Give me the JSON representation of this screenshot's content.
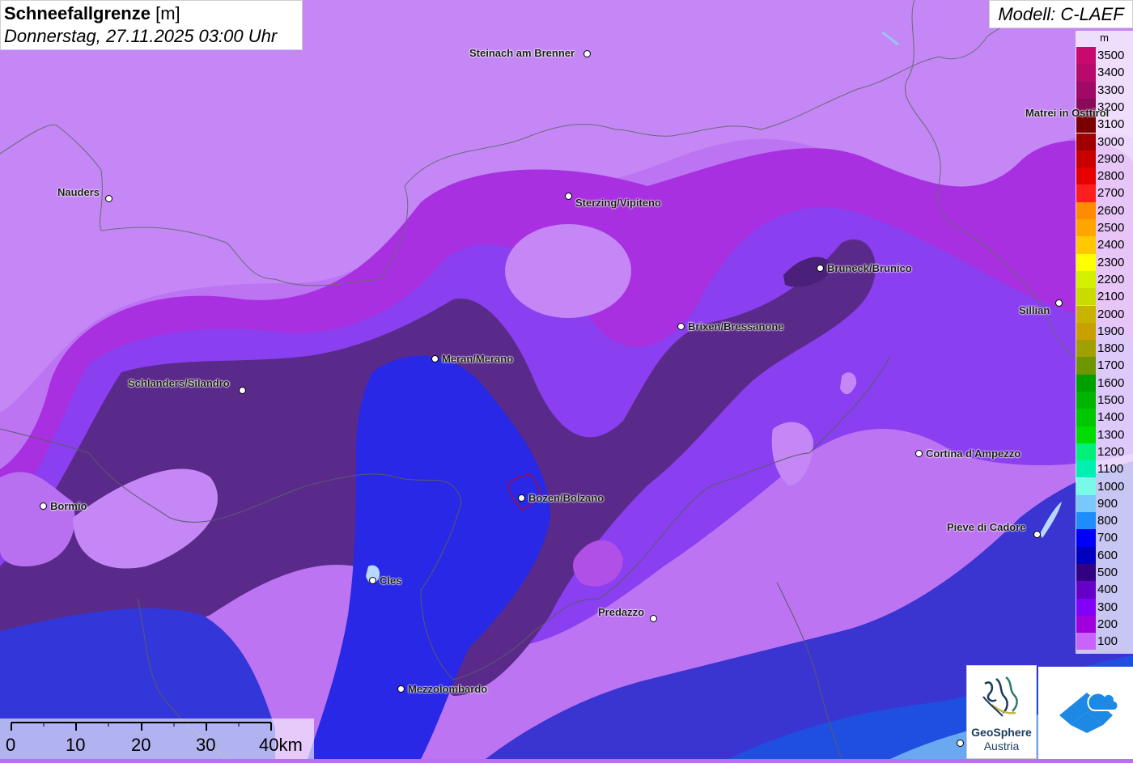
{
  "header": {
    "title_bold": "Schneefallgrenze",
    "title_unit": "[m]",
    "datetime": "Donnerstag, 27.11.2025 03:00 Uhr"
  },
  "model": {
    "label": "Modell: C-LAEF"
  },
  "legend": {
    "unit": "m",
    "entries": [
      {
        "label": "3500",
        "color": "#c80a6e"
      },
      {
        "label": "3400",
        "color": "#b80a6a"
      },
      {
        "label": "3300",
        "color": "#a00a66"
      },
      {
        "label": "3200",
        "color": "#8a0a5a"
      },
      {
        "label": "3100",
        "color": "#7a0000"
      },
      {
        "label": "3000",
        "color": "#a00000"
      },
      {
        "label": "2900",
        "color": "#c80000"
      },
      {
        "label": "2800",
        "color": "#e60000"
      },
      {
        "label": "2700",
        "color": "#ff1e1e"
      },
      {
        "label": "2600",
        "color": "#ff8c00"
      },
      {
        "label": "2500",
        "color": "#ffa500"
      },
      {
        "label": "2400",
        "color": "#ffc800"
      },
      {
        "label": "2300",
        "color": "#ffff00"
      },
      {
        "label": "2200",
        "color": "#d2f000"
      },
      {
        "label": "2100",
        "color": "#c8dc00"
      },
      {
        "label": "2000",
        "color": "#c8b400"
      },
      {
        "label": "1900",
        "color": "#c8a000"
      },
      {
        "label": "1800",
        "color": "#a0a000"
      },
      {
        "label": "1700",
        "color": "#6e9600"
      },
      {
        "label": "1600",
        "color": "#00a000"
      },
      {
        "label": "1500",
        "color": "#00b400"
      },
      {
        "label": "1400",
        "color": "#00c800"
      },
      {
        "label": "1300",
        "color": "#00dc00"
      },
      {
        "label": "1200",
        "color": "#00f078"
      },
      {
        "label": "1100",
        "color": "#00f0b4"
      },
      {
        "label": "1000",
        "color": "#78fae6"
      },
      {
        "label": "900",
        "color": "#78c8fa"
      },
      {
        "label": "800",
        "color": "#1e8cfa"
      },
      {
        "label": "700",
        "color": "#0000fa"
      },
      {
        "label": "600",
        "color": "#0000be"
      },
      {
        "label": "500",
        "color": "#320082"
      },
      {
        "label": "400",
        "color": "#6400c8"
      },
      {
        "label": "300",
        "color": "#8200fa"
      },
      {
        "label": "200",
        "color": "#a000dc"
      },
      {
        "label": "100",
        "color": "#c864fa"
      }
    ]
  },
  "cities": [
    {
      "name": "Steinach am Brenner"
    },
    {
      "name": "Nauders"
    },
    {
      "name": "Sterzing/Vipiteno"
    },
    {
      "name": "Matrei in Osttirol"
    },
    {
      "name": "Bruneck/Brunico"
    },
    {
      "name": "Sillian"
    },
    {
      "name": "Brixen/Bressanone"
    },
    {
      "name": "Meran/Merano"
    },
    {
      "name": "Schlanders/Silandro"
    },
    {
      "name": "Cortina d'Ampezzo"
    },
    {
      "name": "Bozen/Bolzano"
    },
    {
      "name": "Bormio"
    },
    {
      "name": "Pieve di Cadore"
    },
    {
      "name": "Cles"
    },
    {
      "name": "Predazzo"
    },
    {
      "name": "Mezzolombardo"
    }
  ],
  "scale_bar": {
    "ticks": [
      "0",
      "10",
      "20",
      "30",
      "40km"
    ]
  },
  "logos": {
    "geosphere_name": "GeoSphere",
    "geosphere_sub": "Austria"
  }
}
